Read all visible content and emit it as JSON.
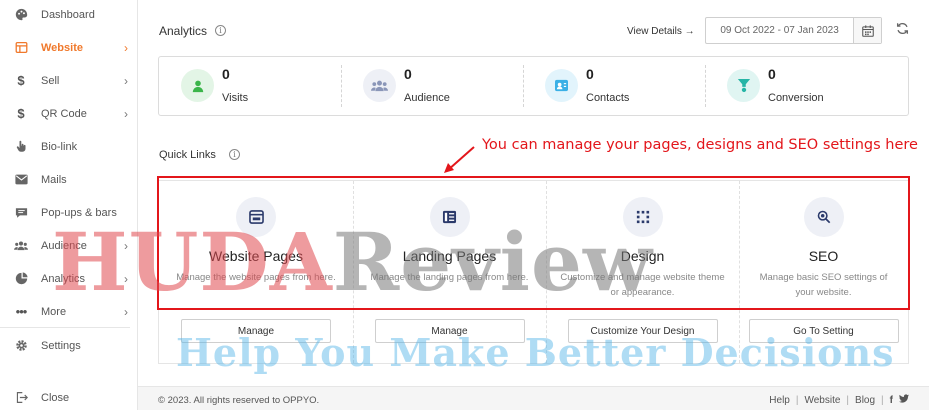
{
  "sidebar": {
    "items": [
      {
        "label": "Dashboard",
        "icon": "palette-icon",
        "chevron": ""
      },
      {
        "label": "Website",
        "icon": "website-icon",
        "chevron": "›"
      },
      {
        "label": "Sell",
        "icon": "dollar-icon",
        "chevron": "›"
      },
      {
        "label": "QR Code",
        "icon": "dollar-icon",
        "chevron": "›"
      },
      {
        "label": "Bio-link",
        "icon": "hand-pointer-icon",
        "chevron": ""
      },
      {
        "label": "Mails",
        "icon": "mail-icon",
        "chevron": ""
      },
      {
        "label": "Pop-ups & bars",
        "icon": "comment-icon",
        "chevron": ""
      },
      {
        "label": "Audience",
        "icon": "users-icon",
        "chevron": "›"
      },
      {
        "label": "Analytics",
        "icon": "chart-icon",
        "chevron": "›"
      },
      {
        "label": "More",
        "icon": "more-icon",
        "chevron": "›"
      },
      {
        "label": "Settings",
        "icon": "gear-icon",
        "chevron": ""
      },
      {
        "label": "Close",
        "icon": "logout-icon",
        "chevron": ""
      }
    ],
    "active_color": "#f0792c"
  },
  "header": {
    "title": "Analytics",
    "view_details": "View Details →",
    "date_range": "09 Oct 2022 - 07 Jan 2023"
  },
  "stats": [
    {
      "value": "0",
      "label": "Visits",
      "icon": "user-icon",
      "color": "#3bb54a",
      "bg": "#e3f5e6"
    },
    {
      "value": "0",
      "label": "Audience",
      "icon": "group-icon",
      "color": "#8a96b8",
      "bg": "#eef0f6"
    },
    {
      "value": "0",
      "label": "Contacts",
      "icon": "contact-card-icon",
      "color": "#3ab0e6",
      "bg": "#e2f4fc"
    },
    {
      "value": "0",
      "label": "Conversion",
      "icon": "funnel-icon",
      "color": "#26b5a6",
      "bg": "#e0f5f2"
    }
  ],
  "quick_links": {
    "title": "Quick Links",
    "cards": [
      {
        "name": "Website Pages",
        "desc": "Manage the website pages from here.",
        "button": "Manage",
        "icon": "browser-window-icon"
      },
      {
        "name": "Landing Pages",
        "desc": "Manage the landing pages from here.",
        "button": "Manage",
        "icon": "landing-page-icon"
      },
      {
        "name": "Design",
        "desc": "Customize and manage website theme or appearance.",
        "button": "Customize Your Design",
        "icon": "grid-dots-icon"
      },
      {
        "name": "SEO",
        "desc": "Manage basic SEO settings of your website.",
        "button": "Go To Setting",
        "icon": "magnifier-icon"
      }
    ]
  },
  "annotation": {
    "text": "You can manage your pages, designs and SEO settings here",
    "color": "#e3161b"
  },
  "watermark": {
    "part1": "HUDA",
    "part2": "Review",
    "tagline": "Help You Make Better Decisions"
  },
  "footer": {
    "copyright": "©  2023. All rights reserved to OPPYO.",
    "links": [
      "Help",
      "Website",
      "Blog"
    ],
    "social": [
      "f",
      "t"
    ]
  }
}
